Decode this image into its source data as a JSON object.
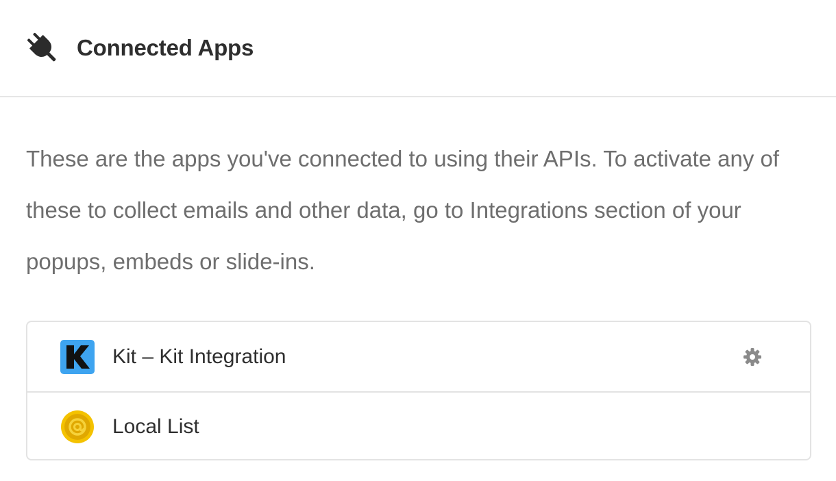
{
  "header": {
    "icon": "plug-icon",
    "title": "Connected Apps"
  },
  "description": "These are the apps you've connected to using their APIs. To activate any of these to collect emails and other data, go to Integrations section of your popups, embeds or slide-ins.",
  "apps": [
    {
      "name": "Kit – Kit Integration",
      "logo": "kit-logo",
      "accent": "#3ea4f0",
      "has_settings": true,
      "settings_icon": "gear-icon"
    },
    {
      "name": "Local List",
      "logo": "local-list-logo",
      "accent": "#f2c500",
      "has_settings": false
    }
  ],
  "colors": {
    "title": "#2e2e2e",
    "text": "#6e6e6e",
    "border": "#e3e3e3",
    "gear": "#8a8a8a"
  }
}
